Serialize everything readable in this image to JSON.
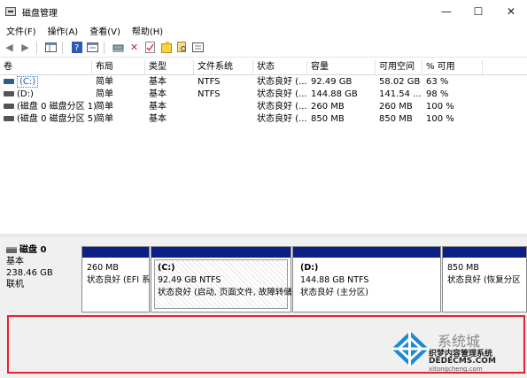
{
  "window": {
    "title": "磁盘管理",
    "controls": {
      "minimize": "—",
      "maximize": "☐",
      "close": "✕"
    }
  },
  "menu": [
    "文件(F)",
    "操作(A)",
    "查看(V)",
    "帮助(H)"
  ],
  "toolbar": {
    "icons": [
      "back-icon",
      "forward-icon",
      "console-tree-icon",
      "help-icon",
      "properties-icon",
      "connect-icon",
      "delete-icon",
      "check-icon",
      "new-folder-icon",
      "search-icon",
      "list-icon"
    ]
  },
  "table": {
    "columns": [
      "卷",
      "布局",
      "类型",
      "文件系统",
      "状态",
      "容量",
      "可用空间",
      "% 可用"
    ],
    "rows": [
      {
        "volume": "(C:)",
        "layout": "简单",
        "type": "基本",
        "fs": "NTFS",
        "status": "状态良好 (...",
        "capacity": "92.49 GB",
        "free": "58.02 GB",
        "pct": "63 %"
      },
      {
        "volume": "(D:)",
        "layout": "简单",
        "type": "基本",
        "fs": "NTFS",
        "status": "状态良好 (...",
        "capacity": "144.88 GB",
        "free": "141.54 ...",
        "pct": "98 %"
      },
      {
        "volume": "(磁盘 0 磁盘分区 1)",
        "layout": "简单",
        "type": "基本",
        "fs": "",
        "status": "状态良好 (...",
        "capacity": "260 MB",
        "free": "260 MB",
        "pct": "100 %"
      },
      {
        "volume": "(磁盘 0 磁盘分区 5)",
        "layout": "简单",
        "type": "基本",
        "fs": "",
        "status": "状态良好 (...",
        "capacity": "850 MB",
        "free": "850 MB",
        "pct": "100 %"
      }
    ]
  },
  "disk": {
    "name": "磁盘 0",
    "type": "基本",
    "size": "238.46 GB",
    "state": "联机",
    "partitions": [
      {
        "label": "",
        "size": "260 MB",
        "status": "状态良好 (EFI 系"
      },
      {
        "label": "(C:)",
        "size": "92.49 GB NTFS",
        "status": "状态良好 (启动, 页面文件, 故障转储"
      },
      {
        "label": "(D:)",
        "size": "144.88 GB NTFS",
        "status": "状态良好 (主分区)"
      },
      {
        "label": "",
        "size": "850 MB",
        "status": "状态良好 (恢复分区"
      }
    ]
  },
  "watermark": {
    "brand": "系统城",
    "line1": "织梦内容管理系统",
    "line2": "DEDECMS.COM",
    "line3": "xitongcheng.com"
  },
  "colors": {
    "partition_bar": "#0b1f86",
    "highlight_box": "#e8212a",
    "watermark_blue": "#1a8ad4"
  }
}
